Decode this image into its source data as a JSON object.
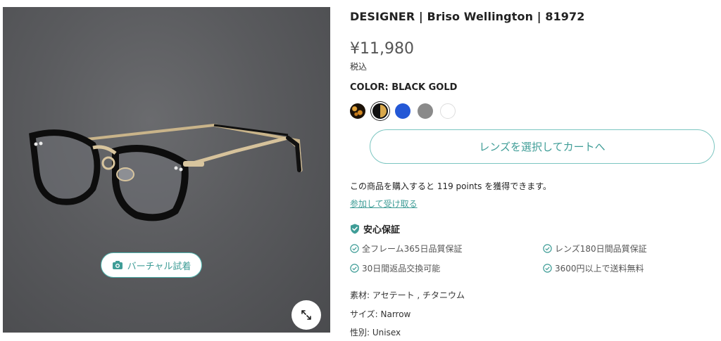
{
  "product": {
    "title": "DESIGNER | Briso Wellington | 81972",
    "price": "¥11,980",
    "tax_note": "税込",
    "color_label": "COLOR: BLACK GOLD"
  },
  "swatches": [
    {
      "name": "tortoise",
      "color": "#1c1208",
      "selected": false
    },
    {
      "name": "black-gold",
      "color": "#d9a84a",
      "selected": true
    },
    {
      "name": "blue",
      "color": "#2458d6",
      "selected": false
    },
    {
      "name": "grey",
      "color": "#8a8a8a",
      "selected": false
    },
    {
      "name": "white",
      "color": "#ffffff",
      "selected": false
    }
  ],
  "image": {
    "tryon_label": "バーチャル試着",
    "camera_icon": "camera-icon",
    "zoom_icon": "expand-icon"
  },
  "cart": {
    "button_label": "レンズを選択してカートへ"
  },
  "points": {
    "text": "この商品を購入すると 119 points を獲得できます。",
    "join_link": "参加して受け取る"
  },
  "guarantee": {
    "heading": "安心保証",
    "items": [
      "全フレーム365日品質保証",
      "レンズ180日間品質保証",
      "30日間返品交換可能",
      "3600円以上で送料無料"
    ]
  },
  "specs": {
    "material": "素材: アセテート , チタニウム",
    "size": "サイズ: Narrow",
    "gender": "性別: Unisex"
  },
  "colors": {
    "accent": "#3f9d97",
    "accent_border": "#7cc6c1",
    "photo_bg": "#5a5b5e"
  }
}
